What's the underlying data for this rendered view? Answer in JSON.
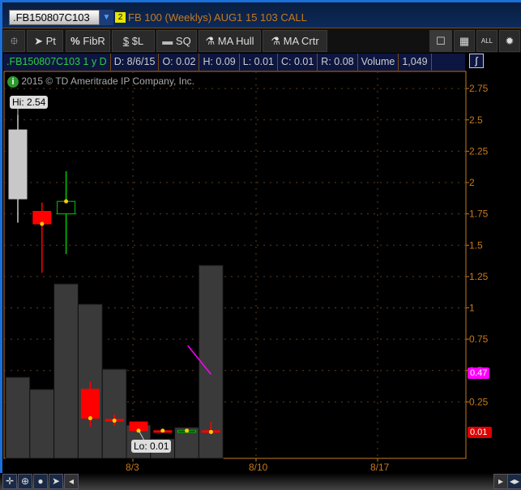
{
  "header": {
    "symbol": ".FB150807C103",
    "link_number": "2",
    "description": "FB 100 (Weeklys) AUG1 15 103 CALL"
  },
  "toolbar": {
    "items": [
      "Pt",
      "FibR",
      "$L",
      "SQ",
      "MA Hull",
      "MA Crtr"
    ],
    "icons": [
      "pin-icon",
      "cursor-icon",
      "percent-icon",
      "dollar-icon",
      "rectangle-icon",
      "flask-icon",
      "flask-icon"
    ],
    "right": [
      "single-layout",
      "grid-layout",
      "ALL",
      "gear"
    ],
    "all_label": "ALL"
  },
  "info": {
    "symbol_period": ".FB150807C103 1 y D",
    "date": "D: 8/6/15",
    "open": "O: 0.02",
    "high": "H: 0.09",
    "low": "L: 0.01",
    "close": "C: 0.01",
    "range": "R: 0.08",
    "volume_label": "Volume",
    "volume": "1,049"
  },
  "copyright": "2015 © TD Ameritrade IP Company, Inc.",
  "hi_label": "Hi: 2.54",
  "lo_label": "Lo: 0.01",
  "last_labels": {
    "study": "0.47",
    "price": "0.01"
  },
  "colors": {
    "up": "#00cc00",
    "down": "#ff0000",
    "axis": "#c87a1a",
    "study": "#ff00ff",
    "volume": "#3a3a3a"
  },
  "chart_data": {
    "type": "candlestick",
    "yticks": [
      "0.25",
      "0.5",
      "0.75",
      "1",
      "1.25",
      "1.5",
      "1.75",
      "2",
      "2.25",
      "2.5",
      "2.75"
    ],
    "ylim": [
      0,
      2.8
    ],
    "xticks": [
      "8/3",
      "8/10",
      "8/17"
    ],
    "candles": [
      {
        "date": "7/27",
        "o": 2.42,
        "h": 2.54,
        "l": 1.68,
        "c": 1.87,
        "color": "#c8c8c8"
      },
      {
        "date": "7/28",
        "o": 1.77,
        "h": 1.84,
        "l": 1.28,
        "c": 1.67,
        "color": "#ff0000"
      },
      {
        "date": "7/29",
        "o": 1.75,
        "h": 2.09,
        "l": 1.43,
        "c": 1.85,
        "color": "#00cc00",
        "hollow": true
      },
      {
        "date": "7/30",
        "o": 0.35,
        "h": 0.41,
        "l": 0.05,
        "c": 0.12,
        "color": "#ff0000"
      },
      {
        "date": "7/31",
        "o": 0.11,
        "h": 0.15,
        "l": 0.06,
        "c": 0.1,
        "color": "#ff0000"
      },
      {
        "date": "8/3",
        "o": 0.09,
        "h": 0.09,
        "l": 0.01,
        "c": 0.02,
        "color": "#ff0000"
      },
      {
        "date": "8/4",
        "o": 0.02,
        "h": 0.03,
        "l": 0.01,
        "c": 0.02,
        "color": "#ff0000"
      },
      {
        "date": "8/5",
        "o": 0.01,
        "h": 0.03,
        "l": 0.01,
        "c": 0.02,
        "color": "#00cc00",
        "hollow": true
      },
      {
        "date": "8/6",
        "o": 0.02,
        "h": 0.09,
        "l": 0.01,
        "c": 0.01,
        "color": "#ff0000"
      }
    ],
    "volume": [
      441,
      375,
      948,
      838,
      485,
      181,
      106,
      168,
      1049
    ],
    "study_line": [
      {
        "date": "8/5",
        "value": 0.7
      },
      {
        "date": "8/6",
        "value": 0.47
      }
    ]
  }
}
